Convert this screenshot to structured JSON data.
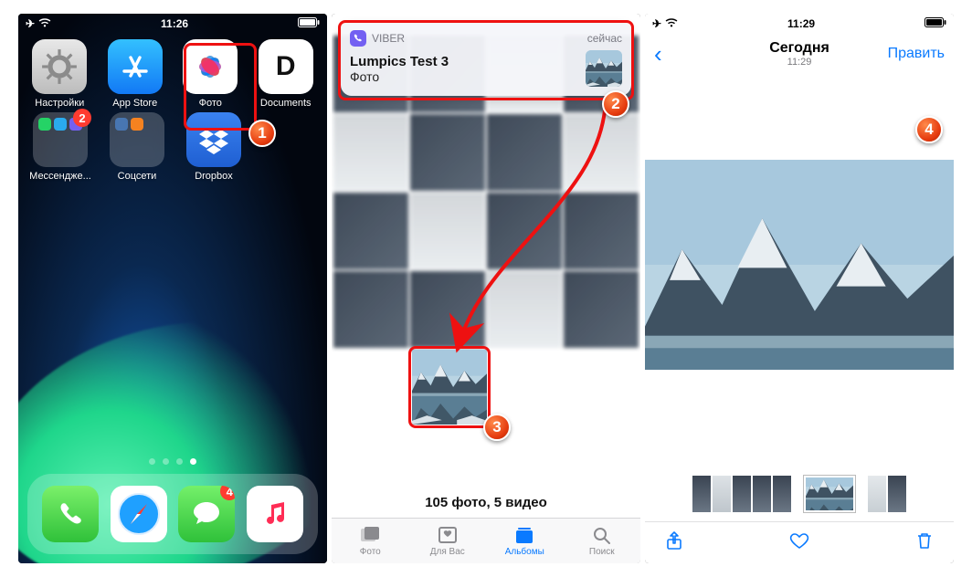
{
  "screen1": {
    "status": {
      "time": "11:26"
    },
    "apps": {
      "settings": "Настройки",
      "appstore": "App Store",
      "photos": "Фото",
      "documents": "Documents",
      "messengers": "Мессендже...",
      "social": "Соцсети",
      "dropbox": "Dropbox"
    },
    "badges": {
      "messengers": "2",
      "messages": "4"
    }
  },
  "screen2": {
    "notification": {
      "app": "VIBER",
      "time": "сейчас",
      "title": "Lumpics Test 3",
      "subtitle": "Фото"
    },
    "library_count": "105 фото, 5 видео",
    "tabs": {
      "photos": "Фото",
      "foryou": "Для Вас",
      "albums": "Альбомы",
      "search": "Поиск"
    }
  },
  "screen3": {
    "status": {
      "time": "11:29"
    },
    "nav": {
      "title": "Сегодня",
      "subtitle": "11:29",
      "edit": "Править"
    }
  },
  "markers": {
    "m1": "1",
    "m2": "2",
    "m3": "3",
    "m4": "4"
  }
}
